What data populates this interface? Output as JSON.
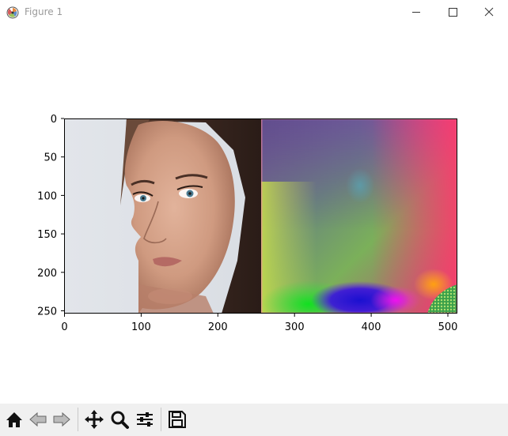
{
  "window": {
    "title": "Figure 1",
    "buttons": {
      "minimize": "minimize-icon",
      "maximize": "maximize-icon",
      "close": "close-icon"
    }
  },
  "plot": {
    "x_ticks": [
      "0",
      "100",
      "200",
      "300",
      "400",
      "500"
    ],
    "y_ticks": [
      "0",
      "50",
      "100",
      "150",
      "200",
      "250"
    ],
    "images": [
      {
        "name": "face-photo",
        "description_icon": "image"
      },
      {
        "name": "color-map",
        "description_icon": "image"
      }
    ]
  },
  "toolbar": {
    "items": [
      {
        "name": "home-icon"
      },
      {
        "name": "back-icon"
      },
      {
        "name": "forward-icon"
      },
      {
        "name": "pan-icon"
      },
      {
        "name": "zoom-icon"
      },
      {
        "name": "subplots-icon"
      },
      {
        "name": "save-icon"
      }
    ]
  },
  "colors": {
    "titlebar_text": "#9a9a9a",
    "toolbar_bg": "#f0f0f0",
    "axis": "#000000"
  }
}
